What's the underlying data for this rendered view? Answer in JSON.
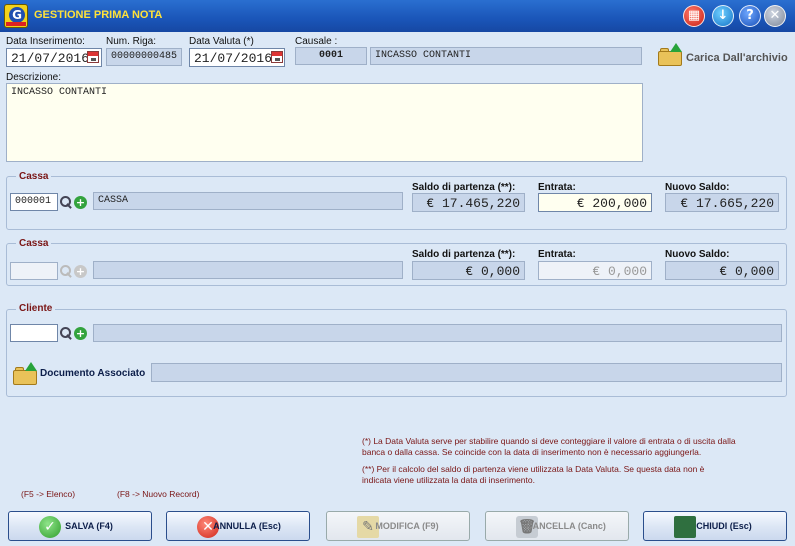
{
  "window": {
    "title": "GESTIONE PRIMA NOTA"
  },
  "header": {
    "data_inserimento_label": "Data Inserimento:",
    "data_inserimento": "21/07/2016",
    "num_riga_label": "Num. Riga:",
    "num_riga": "00000000485",
    "data_valuta_label": "Data Valuta (*)",
    "data_valuta": "21/07/2016",
    "causale_label": "Causale :",
    "causale_code": "0001",
    "causale_desc": "INCASSO CONTANTI",
    "carica_label": "Carica Dall'archivio"
  },
  "descrizione": {
    "label": "Descrizione:",
    "value": "INCASSO CONTANTI"
  },
  "cassa1": {
    "title": "Cassa",
    "code": "000001",
    "name": "CASSA",
    "saldo_label": "Saldo di partenza (**):",
    "saldo": "€ 17.465,220",
    "entrata_label": "Entrata:",
    "entrata": "€ 200,000",
    "nuovo_label": "Nuovo Saldo:",
    "nuovo": "€ 17.665,220"
  },
  "cassa2": {
    "title": "Cassa",
    "code": "",
    "name": "",
    "saldo_label": "Saldo di partenza (**):",
    "saldo": "€ 0,000",
    "entrata_label": "Entrata:",
    "entrata": "€ 0,000",
    "nuovo_label": "Nuovo Saldo:",
    "nuovo": "€ 0,000"
  },
  "cliente": {
    "title": "Cliente",
    "code": "",
    "name": ""
  },
  "documento": {
    "label": "Documento Associato",
    "value": ""
  },
  "notes": {
    "n1a": "(*)  La Data Valuta serve per stabilire quando si deve conteggiare il valore di entrata o di uscita dalla",
    "n1b": "banca o dalla cassa.  Se coincide con la data di inserimento non è necessario aggiungerla.",
    "n2a": "(**)  Per il  calcolo del saldo di partenza viene utilizzata la  Data Valuta. Se questa data non è",
    "n2b": "indicata viene utilizzata la data di inserimento."
  },
  "fkeys": {
    "f5": "(F5 -> Elenco)",
    "f8": "(F8 -> Nuovo Record)"
  },
  "buttons": {
    "salva": "SALVA (F4)",
    "annulla": "ANNULLA (Esc)",
    "modifica": "MODIFICA  (F9)",
    "cancella": "CANCELLA  (Canc)",
    "chiudi": "CHIUDI  (Esc)"
  }
}
